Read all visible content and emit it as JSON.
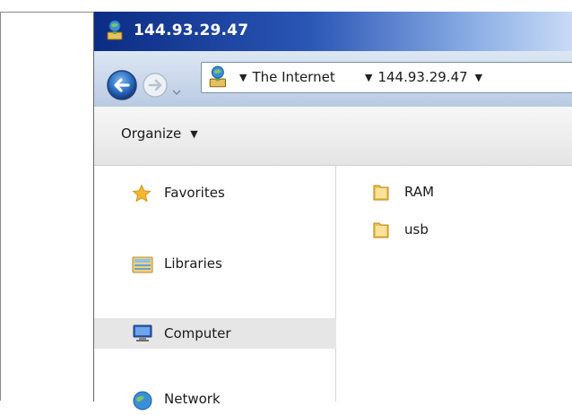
{
  "window": {
    "title": "144.93.29.47"
  },
  "address_bar": {
    "crumbs": [
      "The Internet",
      "144.93.29.47"
    ]
  },
  "toolbar": {
    "organize_label": "Organize"
  },
  "nav_pane": {
    "items": [
      {
        "label": "Favorites",
        "icon": "star-icon"
      },
      {
        "label": "Libraries",
        "icon": "libraries-icon"
      },
      {
        "label": "Computer",
        "icon": "computer-icon",
        "selected": true
      },
      {
        "label": "Network",
        "icon": "network-icon"
      }
    ]
  },
  "files": [
    {
      "label": "RAM",
      "icon": "folder-icon"
    },
    {
      "label": "usb",
      "icon": "folder-icon"
    }
  ],
  "colors": {
    "titlebar_dark": "#0b2c83",
    "titlebar_light": "#c9dbf5",
    "selected_bg": "#e6e6e6",
    "folder": "#f0c24a"
  }
}
